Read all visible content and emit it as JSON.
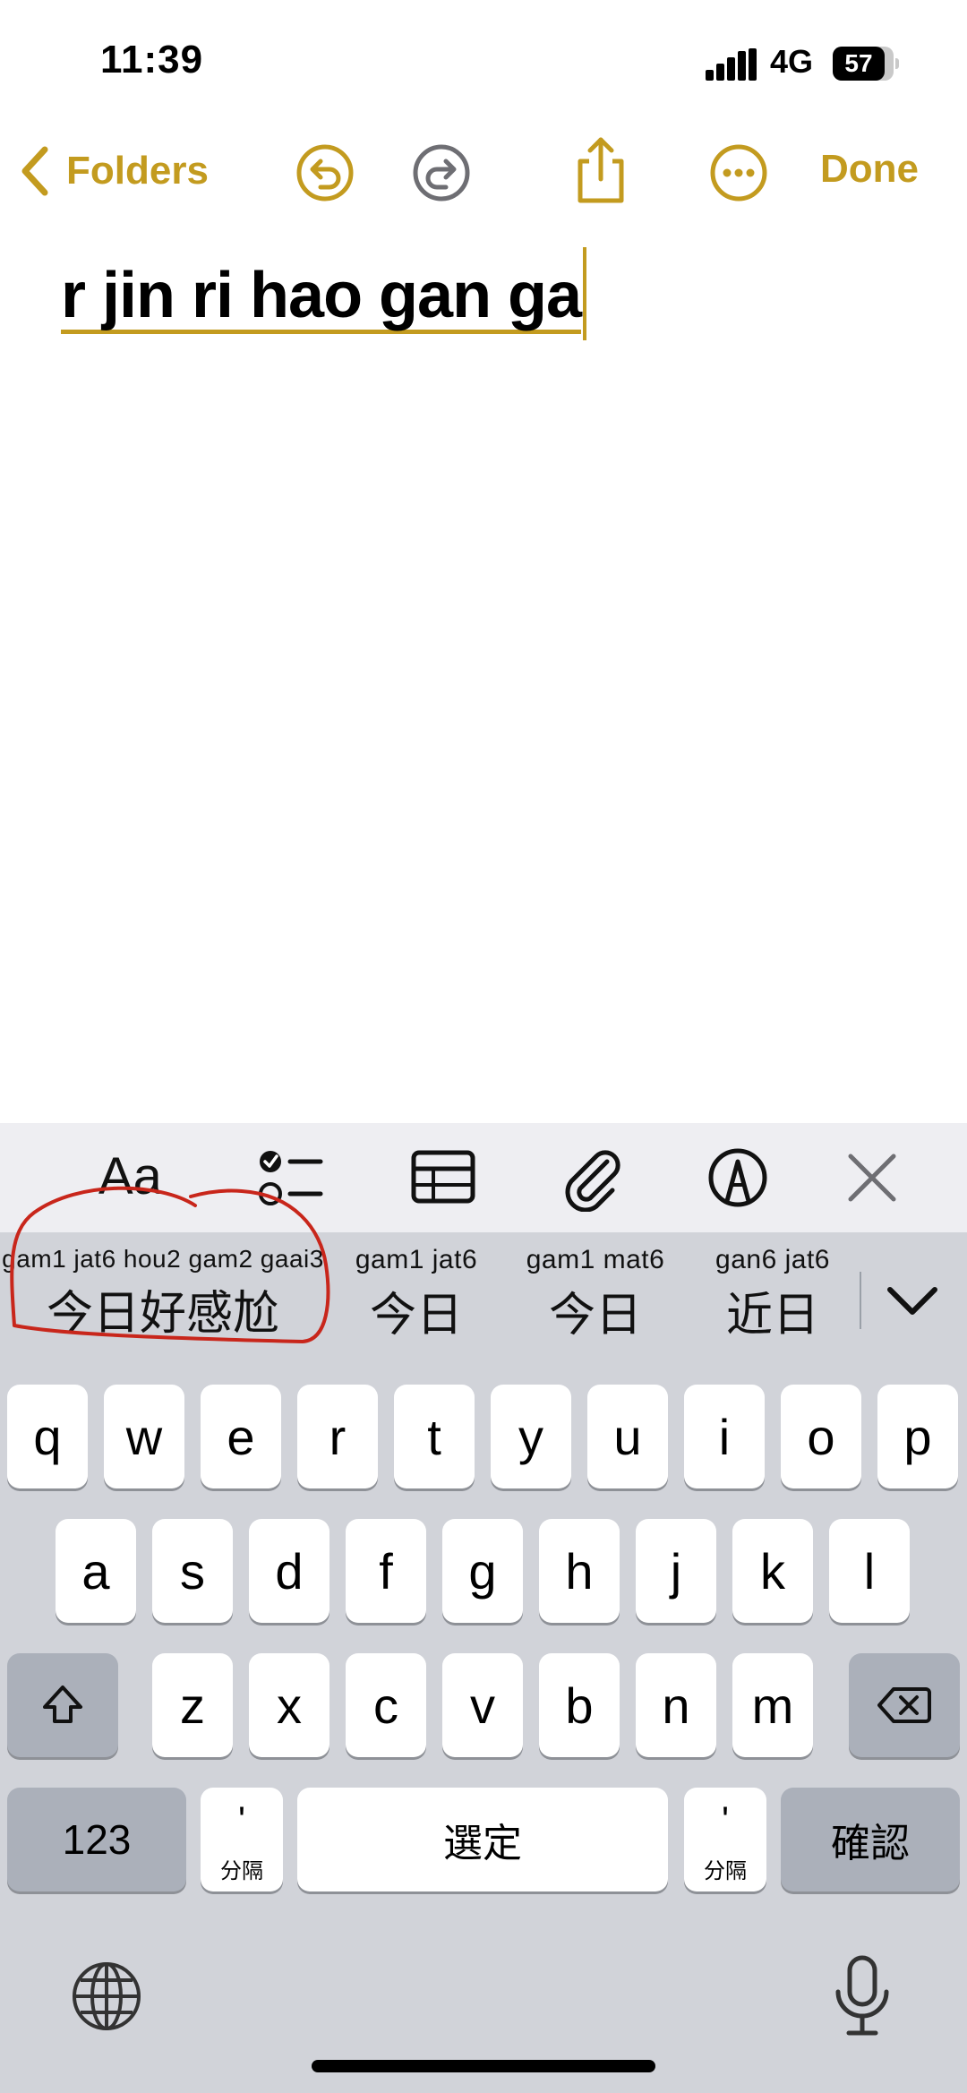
{
  "status": {
    "time": "11:39",
    "network": "4G",
    "battery": "57"
  },
  "nav": {
    "back_label": "Folders",
    "done_label": "Done"
  },
  "note": {
    "text": "r jin ri hao gan ga"
  },
  "colors": {
    "accent": "#C39B1F",
    "keyboard_bg": "#d1d3d9",
    "annotation": "#c8261b"
  },
  "toolbar": {
    "format_label": "Aa",
    "items": [
      "format-icon",
      "checklist-icon",
      "table-icon",
      "attachment-icon",
      "markup-icon",
      "close-icon"
    ]
  },
  "candidates": [
    {
      "roman": "gam1 jat6 hou2 gam2 gaai3",
      "hanzi": "今日好感尬"
    },
    {
      "roman": "gam1 jat6",
      "hanzi": "今日"
    },
    {
      "roman": "gam1 mat6",
      "hanzi": "今日"
    },
    {
      "roman": "gan6 jat6",
      "hanzi": "近日"
    }
  ],
  "keys": {
    "row1": [
      "q",
      "w",
      "e",
      "r",
      "t",
      "y",
      "u",
      "i",
      "o",
      "p"
    ],
    "row2": [
      "a",
      "s",
      "d",
      "f",
      "g",
      "h",
      "j",
      "k",
      "l"
    ],
    "row3": [
      "z",
      "x",
      "c",
      "v",
      "b",
      "n",
      "m"
    ],
    "numbers": "123",
    "separator_top": "'",
    "separator_label": "分隔",
    "space": "選定",
    "confirm": "確認"
  }
}
